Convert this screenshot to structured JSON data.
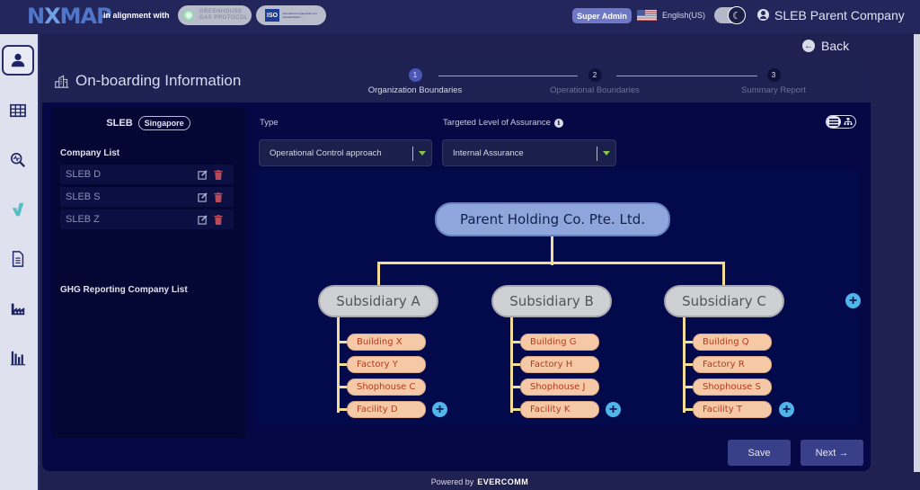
{
  "header": {
    "logo_text_left": "N",
    "logo_text_x": "X",
    "logo_text_right": "MAP",
    "alignment_text": "in alignment with",
    "ghg_badge_line1": "GREENHOUSE",
    "ghg_badge_line2": "GAS PROTOCOL",
    "iso_badge_label": "ISO",
    "iso_badge_text": "International Organization for Standardization",
    "role_badge": "Super Admin",
    "language": "English(US)",
    "theme_toggle_icon": "moon-icon",
    "user_name": "SLEB Parent Company"
  },
  "sidebar": {
    "items": [
      {
        "name": "profile",
        "icon": "user-icon",
        "active": true
      },
      {
        "name": "table",
        "icon": "table-icon",
        "active": false
      },
      {
        "name": "analysis",
        "icon": "search-chart-icon",
        "active": false
      },
      {
        "name": "verify",
        "icon": "check-icon",
        "active": false
      },
      {
        "name": "documents",
        "icon": "document-icon",
        "active": false
      },
      {
        "name": "factory",
        "icon": "factory-icon",
        "active": false
      },
      {
        "name": "reports",
        "icon": "bar-chart-icon",
        "active": false
      }
    ]
  },
  "back_label": "Back",
  "panel": {
    "title": "On-boarding Information",
    "steps": [
      {
        "num": "1",
        "label": "Organization Boundaries",
        "active": true
      },
      {
        "num": "2",
        "label": "Operational Boundaries",
        "active": false
      },
      {
        "num": "3",
        "label": "Summary Report",
        "active": false
      }
    ]
  },
  "left": {
    "org_name": "SLEB",
    "country": "Singapore",
    "company_list_title": "Company List",
    "companies": [
      "SLEB D",
      "SLEB S",
      "SLEB Z"
    ],
    "ghg_list_title": "GHG Reporting Company List"
  },
  "form": {
    "type_label": "Type",
    "type_value": "Operational Control approach",
    "assurance_label": "Targeted Level of Assurance",
    "assurance_value": "Internal Assurance"
  },
  "diagram": {
    "root": "Parent Holding Co. Pte. Ltd.",
    "subsidiaries": [
      {
        "name": "Subsidiary A",
        "children": [
          "Building X",
          "Factory Y",
          "Shophouse C",
          "Facility D"
        ]
      },
      {
        "name": "Subsidiary B",
        "children": [
          "Building G",
          "Factory H",
          "Shophouse J",
          "Facility K"
        ]
      },
      {
        "name": "Subsidiary C",
        "children": [
          "Building Q",
          "Factory R",
          "Shophouse S",
          "Facility T"
        ]
      }
    ],
    "colors": {
      "root": "#8ea6dc",
      "subsidiary": "#cfd0d4",
      "leaf": "#f5c9a6",
      "leaf_text": "#b83a1f",
      "connector": "#f2dc96",
      "add": "#4fb5ea"
    }
  },
  "buttons": {
    "save": "Save",
    "next": "Next →"
  },
  "footer": {
    "powered_by": "Powered by",
    "brand": "EVERCOMM"
  }
}
